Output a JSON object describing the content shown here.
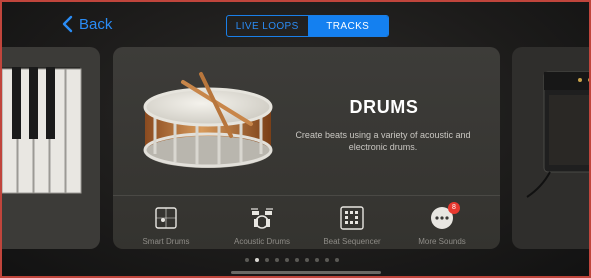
{
  "nav": {
    "back_label": "Back",
    "segments": [
      {
        "label": "LIVE LOOPS",
        "selected": false
      },
      {
        "label": "TRACKS",
        "selected": true
      }
    ]
  },
  "card": {
    "title": "DRUMS",
    "description": "Create beats using a variety of acoustic and electronic drums.",
    "options": [
      {
        "label": "Smart Drums",
        "icon": "smart-drums-icon"
      },
      {
        "label": "Acoustic Drums",
        "icon": "drum-kit-icon"
      },
      {
        "label": "Beat Sequencer",
        "icon": "beat-sequencer-icon"
      },
      {
        "label": "More Sounds",
        "icon": "more-icon",
        "badge": "8"
      }
    ]
  },
  "pager": {
    "page_count": 10,
    "current_page": 2
  },
  "colors": {
    "accent": "#1480f0",
    "badge": "#e8382f",
    "frame": "#c0453c"
  }
}
